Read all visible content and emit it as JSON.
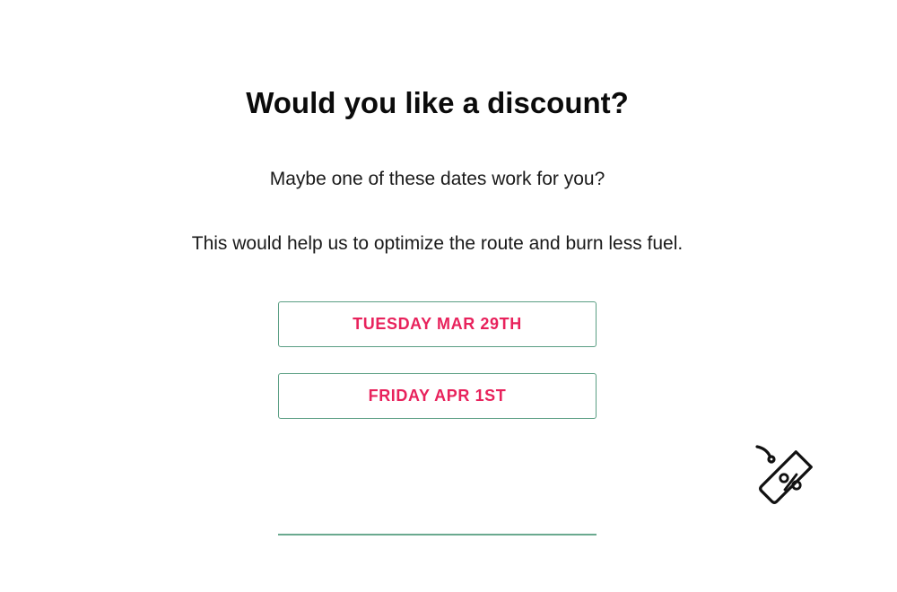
{
  "dialog": {
    "title": "Would you like a discount?",
    "subtitle": "Maybe one of these dates work for you?",
    "explanation": "This would help us to optimize the route and burn less fuel."
  },
  "date_options": [
    {
      "label": "TUESDAY MAR 29TH"
    },
    {
      "label": "FRIDAY APR 1ST"
    }
  ],
  "icons": {
    "discount": "discount-tag-icon"
  },
  "colors": {
    "button_text": "#e8225c",
    "button_border": "#5a9e83",
    "divider": "#6aa98f",
    "title": "#0b0b0b"
  }
}
